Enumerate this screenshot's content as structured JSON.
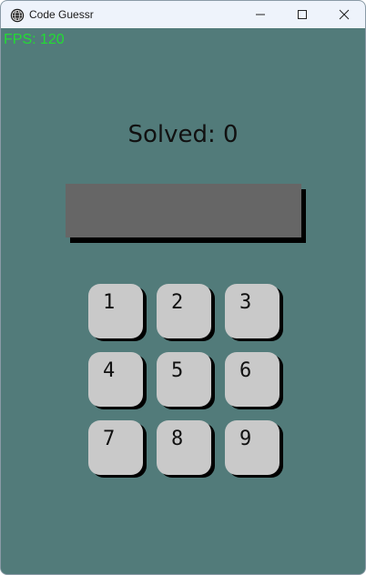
{
  "window": {
    "title": "Code Guessr",
    "icon": "app-globe-icon",
    "controls": [
      "minimize-icon",
      "maximize-icon",
      "close-icon"
    ]
  },
  "hud": {
    "fps_text": "FPS: 120"
  },
  "game": {
    "solved_text": "Solved: 0",
    "solved_count": 0,
    "code_entered": ""
  },
  "keypad": {
    "keys": [
      {
        "label": "1"
      },
      {
        "label": "2"
      },
      {
        "label": "3"
      },
      {
        "label": "4"
      },
      {
        "label": "5"
      },
      {
        "label": "6"
      },
      {
        "label": "7"
      },
      {
        "label": "8"
      },
      {
        "label": "9"
      }
    ]
  },
  "colors": {
    "background": "#527b7a",
    "display": "#666666",
    "key": "#c9c9c9",
    "shadow": "#000000",
    "fps": "#22dd33"
  }
}
